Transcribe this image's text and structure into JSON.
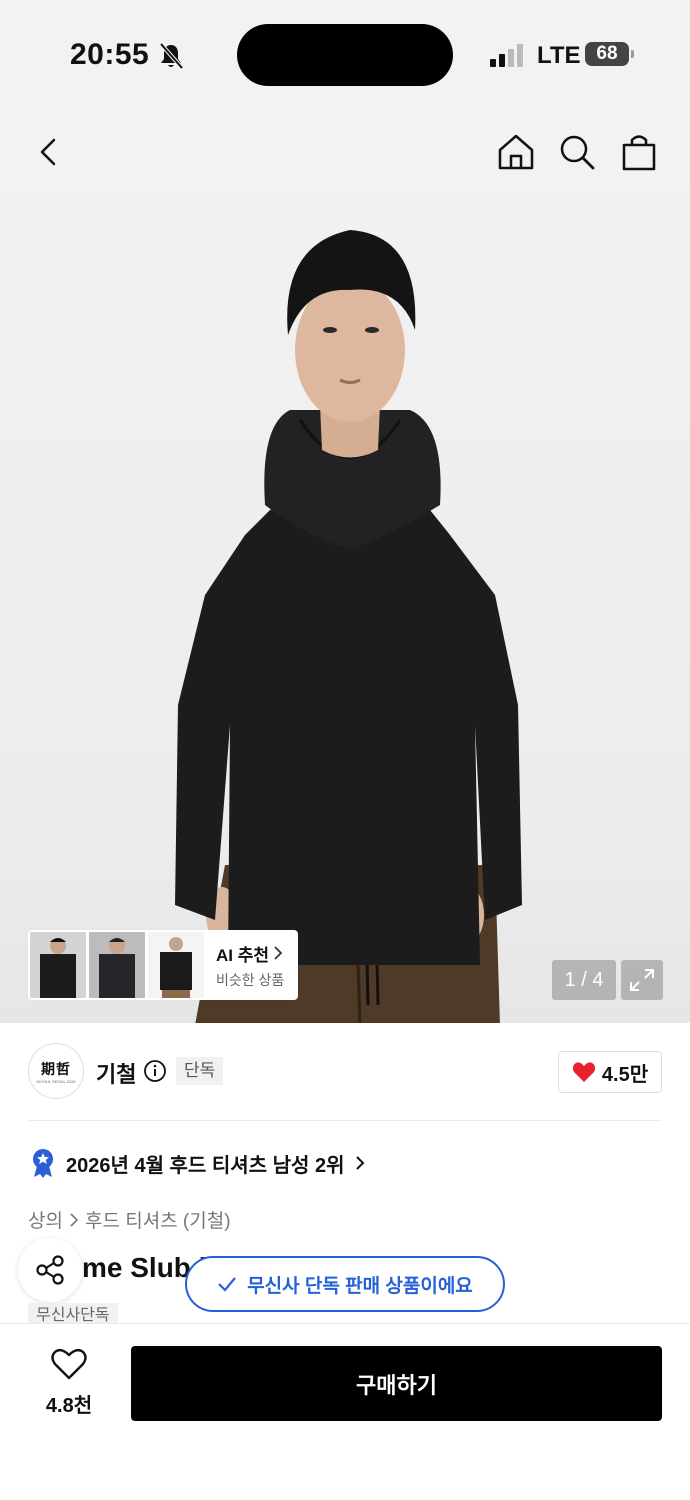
{
  "status": {
    "time": "20:55",
    "network": "LTE",
    "battery": "68"
  },
  "gallery": {
    "pager": "1 / 4"
  },
  "ai_reco": {
    "title": "AI 추천",
    "subtitle": "비슷한 상품"
  },
  "brand": {
    "logo_text": "期哲",
    "logo_sub": "KICHUL SEOUL 2026",
    "name": "기철",
    "tag": "단독",
    "likes": "4.5만"
  },
  "ranking": {
    "text": "2026년 4월 후드 티셔츠 남성 2위"
  },
  "breadcrumb": {
    "level1": "상의",
    "level2": "후드 티셔츠 (기철)"
  },
  "product": {
    "name_visible": "me Slub l",
    "tag": "무신사단독"
  },
  "toast": {
    "text": "무신사 단독 판매 상품이에요"
  },
  "bottom": {
    "wish_count": "4.8천",
    "buy_label": "구매하기"
  },
  "colors": {
    "accent_blue": "#2461d8",
    "heart_red": "#e8232d",
    "buy_bg": "#000000"
  },
  "icons": [
    "bell-off-icon",
    "signal-icon",
    "back-icon",
    "home-icon",
    "search-icon",
    "bag-icon",
    "expand-icon",
    "info-icon",
    "heart-icon",
    "badge-icon",
    "share-icon",
    "check-icon"
  ]
}
